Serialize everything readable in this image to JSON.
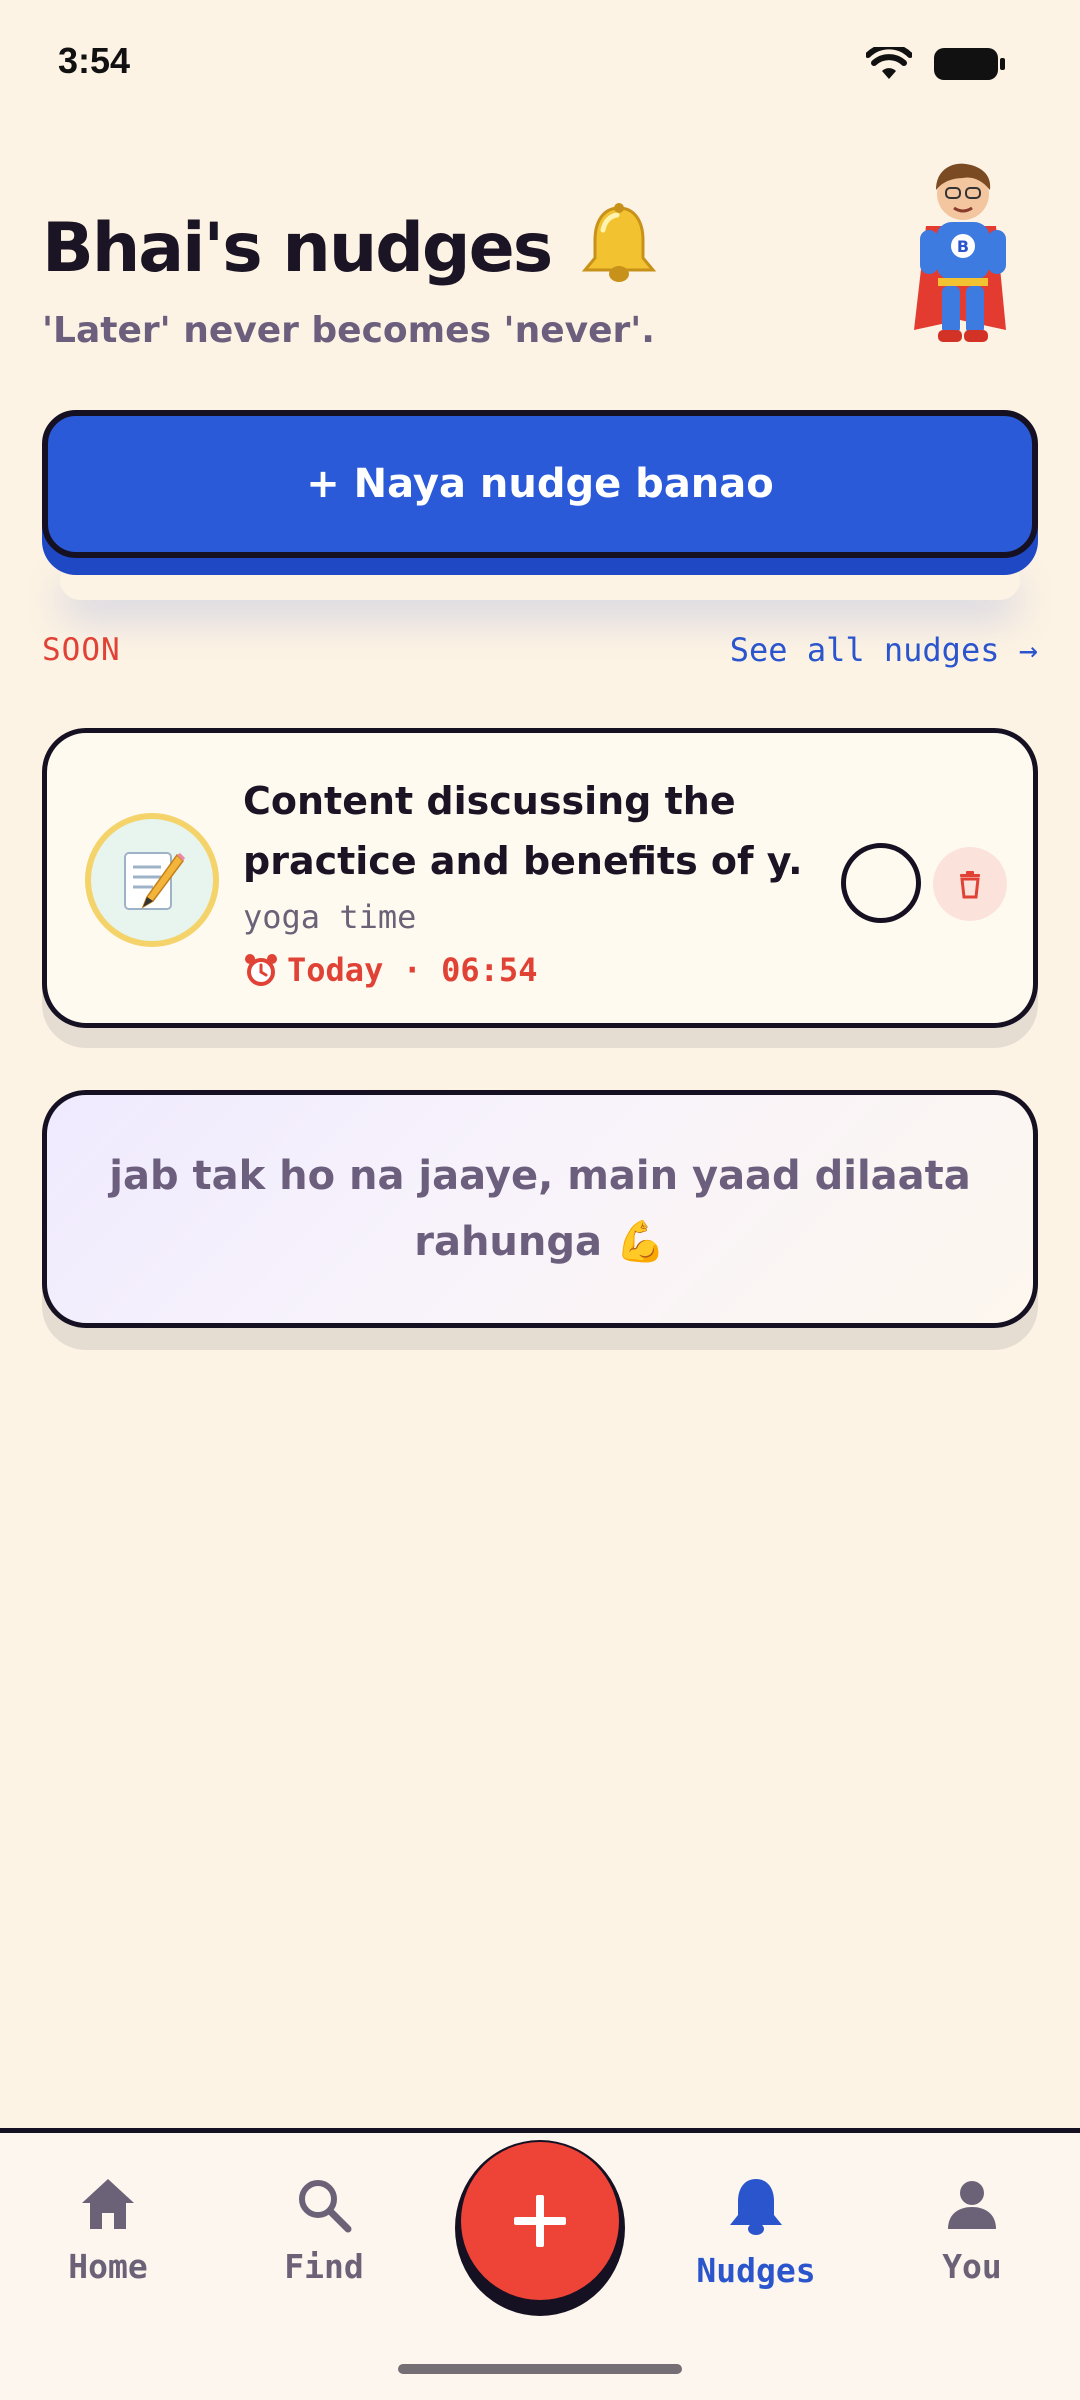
{
  "status_bar": {
    "time": "3:54"
  },
  "header": {
    "title": "Bhai's nudges",
    "title_emoji": "🔔",
    "subtitle": "'Later' never becomes 'never'."
  },
  "mascot": {
    "icon": "superhero-mascot-icon",
    "badge": "B"
  },
  "cta": {
    "label": "+ Naya nudge banao"
  },
  "section": {
    "label": "SOON",
    "see_all": "See all nudges →"
  },
  "nudges": [
    {
      "icon": "memo-icon",
      "title_line1": "Content discussing the",
      "title_line2": "practice and benefits of y...",
      "subtitle": "yoga time",
      "time": "Today · 06:54"
    }
  ],
  "quote": {
    "text": "jab tak ho na jaaye, main yaad dilaata rahunga 💪"
  },
  "nav": {
    "items": [
      {
        "label": "Home",
        "icon": "home-icon",
        "active": false
      },
      {
        "label": "Find",
        "icon": "search-icon",
        "active": false
      },
      {
        "label": "Nudges",
        "icon": "bell-icon",
        "active": true
      },
      {
        "label": "You",
        "icon": "person-icon",
        "active": false
      }
    ],
    "fab_icon": "plus-icon"
  },
  "colors": {
    "background": "#fdf3e4",
    "primary_blue": "#2a5ad8",
    "accent_red": "#ee4438",
    "ink": "#161122",
    "muted": "#6b5f7d"
  }
}
